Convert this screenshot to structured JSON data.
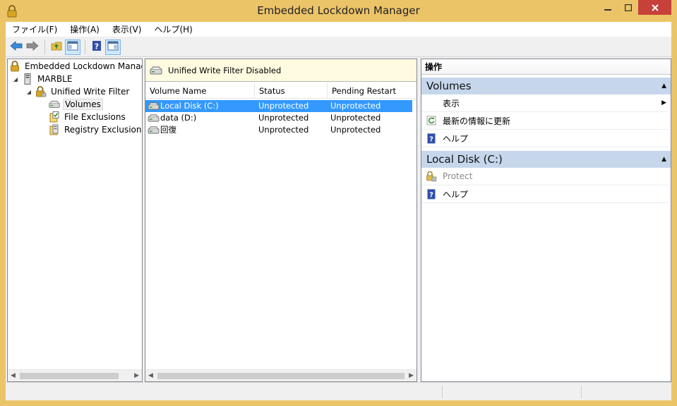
{
  "window": {
    "title": "Embedded Lockdown Manager"
  },
  "menu": [
    "ファイル(F)",
    "操作(A)",
    "表示(V)",
    "ヘルプ(H)"
  ],
  "tree": {
    "root": "Embedded Lockdown Manag",
    "computer": "MARBLE",
    "uwf": "Unified Write Filter",
    "volumes": "Volumes",
    "file_exclusions": "File Exclusions",
    "registry_exclusions": "Registry Exclusions"
  },
  "banner": {
    "text": "Unified Write Filter Disabled"
  },
  "list": {
    "columns": [
      "Volume Name",
      "Status",
      "Pending Restart"
    ],
    "rows": [
      {
        "name": "Local Disk (C:)",
        "status": "Unprotected",
        "pending": "Unprotected"
      },
      {
        "name": "data (D:)",
        "status": "Unprotected",
        "pending": "Unprotected"
      },
      {
        "name": "回復",
        "status": "Unprotected",
        "pending": "Unprotected"
      }
    ]
  },
  "actions": {
    "title": "操作",
    "section1": {
      "name": "Volumes",
      "items": [
        "表示",
        "最新の情報に更新",
        "ヘルプ"
      ]
    },
    "section2": {
      "name": "Local Disk (C:)",
      "items": [
        "Protect",
        "ヘルプ"
      ]
    }
  },
  "colors": {
    "frame": "#ecc468",
    "selection": "#3399ff",
    "section": "#c6d7ec",
    "close": "#c7403a"
  }
}
